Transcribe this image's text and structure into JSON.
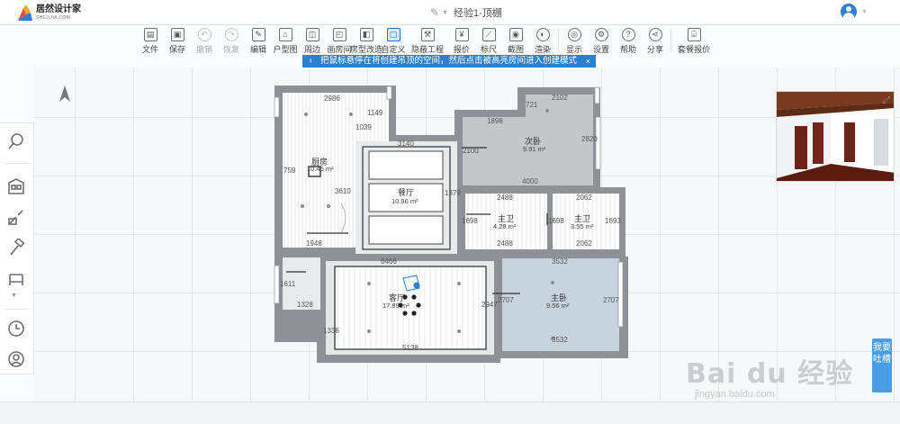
{
  "header": {
    "logo_name": "居然设计家",
    "logo_sub": "SHEJIJIA.COM",
    "doc_title": "经验1-顶棚"
  },
  "toolbar": {
    "items": [
      {
        "label": "文件",
        "icon": "file-icon"
      },
      {
        "label": "保存",
        "icon": "save-icon"
      },
      {
        "label": "撤销",
        "icon": "undo-icon",
        "disabled": true
      },
      {
        "label": "恢复",
        "icon": "redo-icon",
        "disabled": true
      },
      {
        "label": "编辑",
        "icon": "edit-icon"
      },
      {
        "label": "户型图",
        "icon": "floorplan-icon"
      },
      {
        "label": "周边",
        "icon": "perimeter-icon"
      },
      {
        "label": "画房间",
        "icon": "draw-room-icon"
      },
      {
        "label": "房型改造",
        "icon": "renovate-icon"
      },
      {
        "label": "自定义",
        "icon": "custom-icon",
        "active": true
      },
      {
        "label": "隐蔽工程",
        "icon": "hidden-works-icon"
      },
      {
        "label": "报价",
        "icon": "quote-icon"
      },
      {
        "label": "标尺",
        "icon": "ruler-icon"
      },
      {
        "label": "截图",
        "icon": "screenshot-icon"
      },
      {
        "label": "渲染",
        "icon": "render-icon"
      },
      {
        "label": "显示",
        "icon": "eye-icon"
      },
      {
        "label": "设置",
        "icon": "gear-icon"
      },
      {
        "label": "帮助",
        "icon": "help-icon"
      },
      {
        "label": "分享",
        "icon": "share-icon"
      },
      {
        "label": "套餐报价",
        "icon": "package-quote-icon"
      }
    ]
  },
  "hint": {
    "text": "把鼠标悬停在将创建吊顶的空间，然后点击被高亮房间进入创建模式",
    "close": "×"
  },
  "feedback_label": "我要吐槽",
  "watermark": {
    "main": "Bai du 经验",
    "sub": "jingyan.baidu.com"
  },
  "floorplan": {
    "rooms": [
      {
        "name": "厨房",
        "area": "10.46 m²"
      },
      {
        "name": "餐厅",
        "area": "10.96 m²"
      },
      {
        "name": "次卧",
        "area": "9.91 m²"
      },
      {
        "name": "主卫",
        "area": "4.28 m²"
      },
      {
        "name": "主卫",
        "area": "3.55 m²"
      },
      {
        "name": "客厅",
        "area": "17.89 m²"
      },
      {
        "name": "主卧",
        "area": "9.56 m²"
      }
    ],
    "dims": [
      "2986",
      "1149",
      "1039",
      "759",
      "3610",
      "1948",
      "3140",
      "1898",
      "2102",
      "721",
      "2820",
      "2100",
      "4000",
      "1379",
      "2488",
      "2062",
      "1698",
      "1698",
      "1693",
      "2488",
      "2062",
      "6466",
      "3532",
      "1611",
      "1328",
      "2947",
      "2707",
      "2707",
      "1336",
      "5138",
      "3532"
    ]
  },
  "colors": {
    "accent": "#2b80d1",
    "wall": "#8e9195",
    "room_grey": "#c5c6c8",
    "master_bedroom": "#c7d3de"
  }
}
